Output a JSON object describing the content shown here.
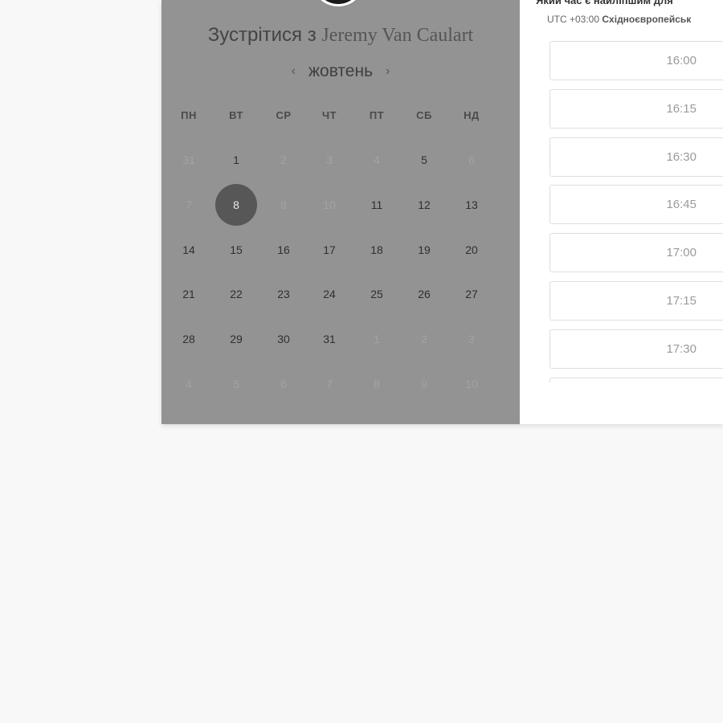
{
  "meeting": {
    "title_prefix": "Зустрітися з",
    "host_name": "Jeremy Van Caulart"
  },
  "calendar": {
    "month": "жовтень",
    "prev_label": "‹",
    "next_label": "›",
    "weekdays": [
      "ПН",
      "ВТ",
      "СР",
      "ЧТ",
      "ПТ",
      "СБ",
      "НД"
    ],
    "weeks": [
      [
        {
          "d": "31",
          "s": "muted"
        },
        {
          "d": "1",
          "s": "avail"
        },
        {
          "d": "2",
          "s": "muted"
        },
        {
          "d": "3",
          "s": "muted"
        },
        {
          "d": "4",
          "s": "muted"
        },
        {
          "d": "5",
          "s": "avail"
        },
        {
          "d": "6",
          "s": "muted"
        }
      ],
      [
        {
          "d": "7",
          "s": "muted"
        },
        {
          "d": "8",
          "s": "selected"
        },
        {
          "d": "9",
          "s": "muted"
        },
        {
          "d": "10",
          "s": "muted"
        },
        {
          "d": "11",
          "s": "avail"
        },
        {
          "d": "12",
          "s": "avail"
        },
        {
          "d": "13",
          "s": "avail"
        }
      ],
      [
        {
          "d": "14",
          "s": "avail"
        },
        {
          "d": "15",
          "s": "avail"
        },
        {
          "d": "16",
          "s": "avail"
        },
        {
          "d": "17",
          "s": "avail"
        },
        {
          "d": "18",
          "s": "avail"
        },
        {
          "d": "19",
          "s": "avail"
        },
        {
          "d": "20",
          "s": "avail"
        }
      ],
      [
        {
          "d": "21",
          "s": "avail"
        },
        {
          "d": "22",
          "s": "avail"
        },
        {
          "d": "23",
          "s": "avail"
        },
        {
          "d": "24",
          "s": "avail"
        },
        {
          "d": "25",
          "s": "avail"
        },
        {
          "d": "26",
          "s": "avail"
        },
        {
          "d": "27",
          "s": "avail"
        }
      ],
      [
        {
          "d": "28",
          "s": "avail"
        },
        {
          "d": "29",
          "s": "avail"
        },
        {
          "d": "30",
          "s": "avail"
        },
        {
          "d": "31",
          "s": "avail"
        },
        {
          "d": "1",
          "s": "muted"
        },
        {
          "d": "2",
          "s": "muted"
        },
        {
          "d": "3",
          "s": "muted"
        }
      ],
      [
        {
          "d": "4",
          "s": "muted"
        },
        {
          "d": "5",
          "s": "muted"
        },
        {
          "d": "6",
          "s": "muted"
        },
        {
          "d": "7",
          "s": "muted"
        },
        {
          "d": "8",
          "s": "muted"
        },
        {
          "d": "9",
          "s": "muted"
        },
        {
          "d": "10",
          "s": "muted"
        }
      ]
    ]
  },
  "times": {
    "heading": "Який час є найліпшим для",
    "timezone_offset": "UTC +03:00",
    "timezone_name": "Східноєвропейськ",
    "slots": [
      "16:00",
      "16:15",
      "16:30",
      "16:45",
      "17:00",
      "17:15",
      "17:30"
    ]
  },
  "colors": {
    "page_bg": "#f8f8f8",
    "calendar_overlay": "#939393",
    "selected_day": "#575757"
  }
}
